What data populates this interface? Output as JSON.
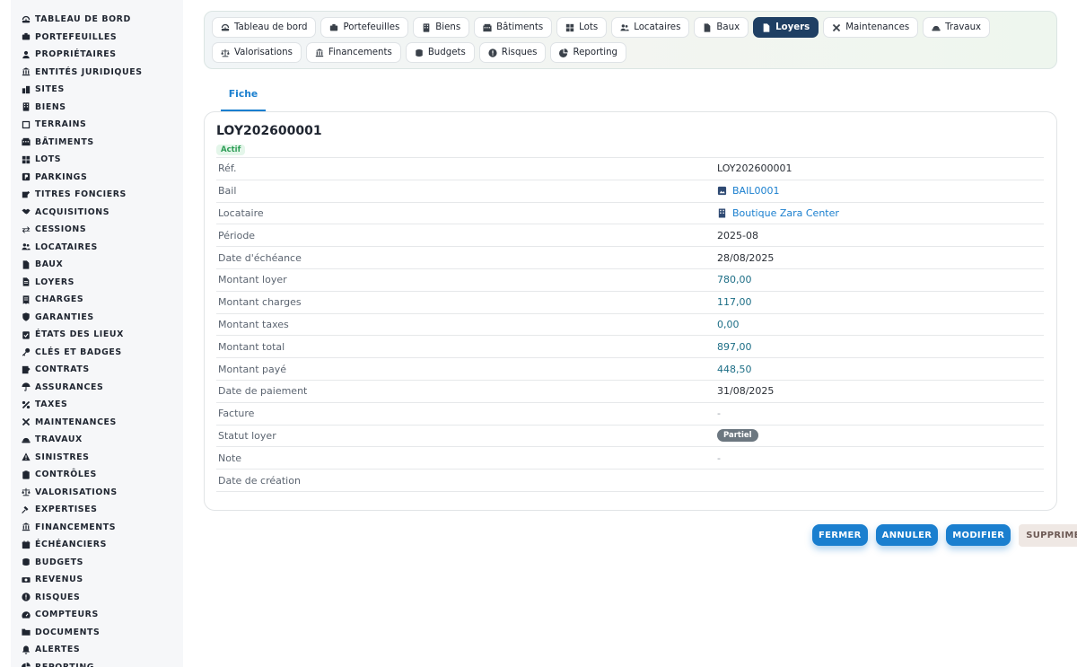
{
  "sidebar": {
    "items": [
      {
        "label": "TABLEAU DE BORD",
        "icon": "dashboard-icon"
      },
      {
        "label": "PORTEFEUILLES",
        "icon": "briefcase-icon"
      },
      {
        "label": "PROPRIÉTAIRES",
        "icon": "user-icon"
      },
      {
        "label": "ENTITÉS JURIDIQUES",
        "icon": "institution-icon"
      },
      {
        "label": "SITES",
        "icon": "city-icon"
      },
      {
        "label": "BIENS",
        "icon": "building-icon"
      },
      {
        "label": "TERRAINS",
        "icon": "terrain-icon"
      },
      {
        "label": "BÂTIMENTS",
        "icon": "buildings-icon"
      },
      {
        "label": "LOTS",
        "icon": "grid-icon"
      },
      {
        "label": "PARKINGS",
        "icon": "parking-icon"
      },
      {
        "label": "TITRES FONCIERS",
        "icon": "deed-icon"
      },
      {
        "label": "ACQUISITIONS",
        "icon": "handshake-icon"
      },
      {
        "label": "CESSIONS",
        "icon": "exchange-icon"
      },
      {
        "label": "LOCATAIRES",
        "icon": "users-icon"
      },
      {
        "label": "BAUX",
        "icon": "file-icon"
      },
      {
        "label": "LOYERS",
        "icon": "file-invoice-icon"
      },
      {
        "label": "CHARGES",
        "icon": "receipt-icon"
      },
      {
        "label": "GARANTIES",
        "icon": "shield-icon"
      },
      {
        "label": "ÉTATS DES LIEUX",
        "icon": "clipboard-check-icon"
      },
      {
        "label": "CLÉS ET BADGES",
        "icon": "key-icon"
      },
      {
        "label": "CONTRATS",
        "icon": "contract-icon"
      },
      {
        "label": "ASSURANCES",
        "icon": "umbrella-icon"
      },
      {
        "label": "TAXES",
        "icon": "percent-icon"
      },
      {
        "label": "MAINTENANCES",
        "icon": "tools-icon"
      },
      {
        "label": "TRAVAUX",
        "icon": "hard-hat-icon"
      },
      {
        "label": "SINISTRES",
        "icon": "warning-icon"
      },
      {
        "label": "CONTRÔLES",
        "icon": "clipboard-icon"
      },
      {
        "label": "VALORISATIONS",
        "icon": "scale-icon"
      },
      {
        "label": "EXPERTISES",
        "icon": "gavel-icon"
      },
      {
        "label": "FINANCEMENTS",
        "icon": "bank-icon"
      },
      {
        "label": "ÉCHÉANCIERS",
        "icon": "calendar-icon"
      },
      {
        "label": "BUDGETS",
        "icon": "coins-icon"
      },
      {
        "label": "REVENUS",
        "icon": "money-icon"
      },
      {
        "label": "RISQUES",
        "icon": "exclamation-icon"
      },
      {
        "label": "COMPTEURS",
        "icon": "gauge-icon"
      },
      {
        "label": "DOCUMENTS",
        "icon": "folder-icon"
      },
      {
        "label": "ALERTES",
        "icon": "bell-icon"
      },
      {
        "label": "REPORTING",
        "icon": "chart-pie-icon"
      }
    ]
  },
  "tabs": [
    {
      "label": "Tableau de bord",
      "icon": "dashboard-icon",
      "active": false
    },
    {
      "label": "Portefeuilles",
      "icon": "briefcase-icon",
      "active": false
    },
    {
      "label": "Biens",
      "icon": "building-icon",
      "active": false
    },
    {
      "label": "Bâtiments",
      "icon": "buildings-icon",
      "active": false
    },
    {
      "label": "Lots",
      "icon": "grid-icon",
      "active": false
    },
    {
      "label": "Locataires",
      "icon": "users-icon",
      "active": false
    },
    {
      "label": "Baux",
      "icon": "file-icon",
      "active": false
    },
    {
      "label": "Loyers",
      "icon": "file-invoice-icon",
      "active": true
    },
    {
      "label": "Maintenances",
      "icon": "tools-icon",
      "active": false
    },
    {
      "label": "Travaux",
      "icon": "hard-hat-icon",
      "active": false
    },
    {
      "label": "Valorisations",
      "icon": "scale-icon",
      "active": false
    },
    {
      "label": "Financements",
      "icon": "bank-icon",
      "active": false
    },
    {
      "label": "Budgets",
      "icon": "coins-icon",
      "active": false
    },
    {
      "label": "Risques",
      "icon": "exclamation-icon",
      "active": false
    },
    {
      "label": "Reporting",
      "icon": "chart-pie-icon",
      "active": false
    }
  ],
  "subtab": {
    "label": "Fiche"
  },
  "record": {
    "title": "LOY202600001",
    "status_badge": "Actif",
    "fields": [
      {
        "label": "Réf.",
        "value": "LOY202600001",
        "kind": "text"
      },
      {
        "label": "Bail",
        "value": "BAIL0001",
        "kind": "link",
        "icon": "file-contract-icon"
      },
      {
        "label": "Locataire",
        "value": "Boutique Zara Center",
        "kind": "link",
        "icon": "building-icon"
      },
      {
        "label": "Période",
        "value": "2025-08",
        "kind": "text"
      },
      {
        "label": "Date d'échéance",
        "value": "28/08/2025",
        "kind": "text"
      },
      {
        "label": "Montant loyer",
        "value": "780,00",
        "kind": "money"
      },
      {
        "label": "Montant charges",
        "value": "117,00",
        "kind": "money"
      },
      {
        "label": "Montant taxes",
        "value": "0,00",
        "kind": "money"
      },
      {
        "label": "Montant total",
        "value": "897,00",
        "kind": "money"
      },
      {
        "label": "Montant payé",
        "value": "448,50",
        "kind": "money"
      },
      {
        "label": "Date de paiement",
        "value": "31/08/2025",
        "kind": "text"
      },
      {
        "label": "Facture",
        "value": "-",
        "kind": "muted"
      },
      {
        "label": "Statut loyer",
        "value": "Partiel",
        "kind": "pill"
      },
      {
        "label": "Note",
        "value": "-",
        "kind": "muted"
      },
      {
        "label": "Date de création",
        "value": "",
        "kind": "text"
      }
    ]
  },
  "actions": {
    "close": "FERMER",
    "cancel": "ANNULER",
    "edit": "MODIFIER",
    "delete": "SUPPRIMER"
  },
  "colors": {
    "accent": "#1a7fcf",
    "active_tab": "#1f3f63",
    "badge_green": "#2f9e57",
    "pill_gray": "#6c7780"
  }
}
